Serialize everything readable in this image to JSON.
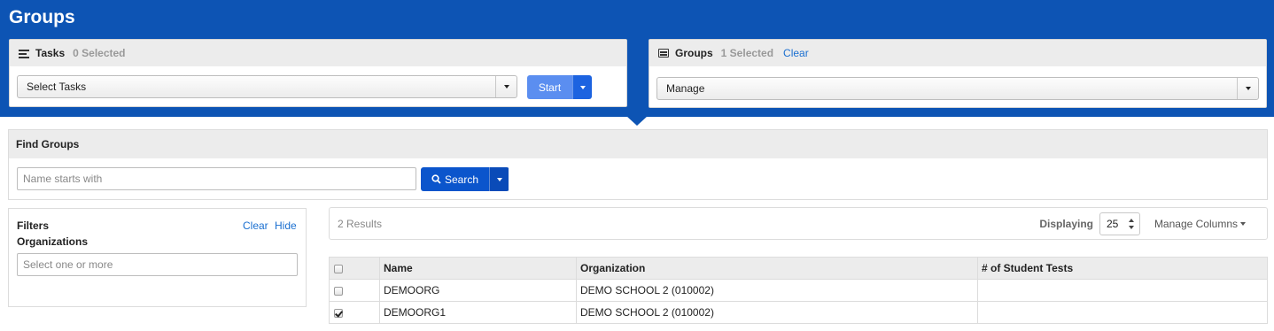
{
  "header": {
    "title": "Groups"
  },
  "tasks_panel": {
    "label": "Tasks",
    "count": "0 Selected",
    "select_value": "Select Tasks",
    "start_label": "Start",
    "start_color": "#4f86e8"
  },
  "groups_panel": {
    "label": "Groups",
    "count": "1 Selected",
    "clear_label": "Clear",
    "select_value": "Manage"
  },
  "find": {
    "title": "Find Groups",
    "placeholder": "Name starts with",
    "search_label": "Search",
    "search_color": "#0b55cc"
  },
  "filters": {
    "title": "Filters",
    "clear_label": "Clear",
    "hide_label": "Hide",
    "organizations_label": "Organizations",
    "organizations_placeholder": "Select one or more"
  },
  "results": {
    "count_text": "2 Results",
    "displaying_label": "Displaying",
    "page_size": "25",
    "manage_columns_label": "Manage Columns"
  },
  "table": {
    "columns": [
      "Name",
      "Organization",
      "# of Student Tests"
    ],
    "rows": [
      {
        "name": "DEMOORG",
        "organization": "DEMO SCHOOL 2 (010002)",
        "student_tests": "",
        "checked": false
      },
      {
        "name": "DEMOORG1",
        "organization": "DEMO SCHOOL 2 (010002)",
        "student_tests": "",
        "checked": true
      }
    ]
  },
  "colors": {
    "header_blue": "#0d54b4",
    "link_blue": "#1a6fd0"
  }
}
